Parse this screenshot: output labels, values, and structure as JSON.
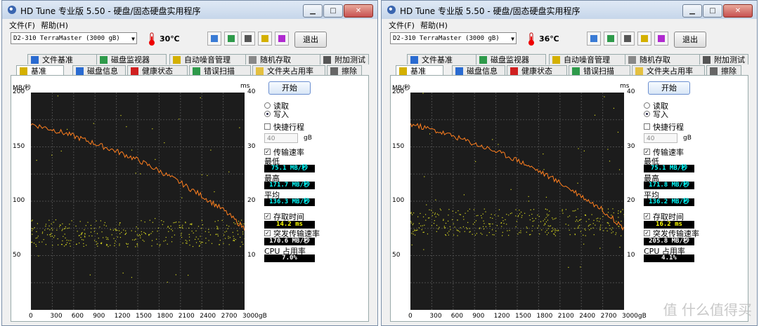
{
  "windows": [
    {
      "title": "HD Tune 专业版 5.50 - 硬盘/固态硬盘实用程序",
      "menu": [
        "文件(F)",
        "帮助(H)"
      ],
      "drive": "D2-310  TerraMaster (3000 gB)",
      "temperature": "30℃",
      "exit_label": "退出",
      "tabs_row1": [
        "文件基准",
        "磁盘监视器",
        "自动噪音管理",
        "随机存取",
        "附加测试"
      ],
      "tabs_row2": [
        "基准",
        "磁盘信息",
        "健康状态",
        "错误扫描",
        "文件夹占用率",
        "擦除"
      ],
      "start_label": "开始",
      "read_label": "读取",
      "write_label": "写入",
      "short_stroke_label": "快捷行程",
      "short_stroke_value": "40",
      "short_stroke_unit": "gB",
      "transfer_label": "传输速率",
      "min_label": "最低",
      "min_value": "75.1 MB/秒",
      "max_label": "最高",
      "max_value": "171.7 MB/秒",
      "avg_label": "平均",
      "avg_value": "136.3 MB/秒",
      "access_label": "存取时间",
      "access_value": "14.2 ms",
      "burst_label": "突发传输速率",
      "burst_value": "170.6 MB/秒",
      "cpu_label": "CPU 占用率",
      "cpu_value": "7.0%",
      "ylabel_left": "MB/秒",
      "ylabel_right": "ms",
      "y_left_ticks": [
        "200",
        "150",
        "100",
        "50"
      ],
      "y_right_ticks": [
        "40",
        "30",
        "20",
        "10"
      ],
      "x_ticks": [
        "0",
        "300",
        "600",
        "900",
        "1200",
        "1500",
        "1800",
        "2100",
        "2400",
        "2700",
        "3000gB"
      ],
      "chart_data": {
        "type": "line",
        "x": [
          0,
          300,
          600,
          900,
          1200,
          1500,
          1800,
          2100,
          2400,
          2700,
          3000
        ],
        "series": [
          {
            "values": [
              171,
              166,
              160,
              153,
              146,
              138,
              128,
              117,
              105,
              92,
              75
            ]
          }
        ],
        "ylim_left": [
          0,
          200
        ],
        "ylim_right": [
          0,
          40
        ],
        "access_band_ms": 14.2,
        "grid": true
      },
      "colors": {
        "line": "#ff7f1f",
        "dots": "#d8d820",
        "min": "#00ffff",
        "access": "#ffff00",
        "cpu": "#ffffff"
      }
    },
    {
      "title": "HD Tune 专业版 5.50 - 硬盘/固态硬盘实用程序",
      "menu": [
        "文件(F)",
        "帮助(H)"
      ],
      "drive": "D2-310  TerraMaster (3000 gB)",
      "temperature": "36℃",
      "exit_label": "退出",
      "tabs_row1": [
        "文件基准",
        "磁盘监视器",
        "自动噪音管理",
        "随机存取",
        "附加测试"
      ],
      "tabs_row2": [
        "基准",
        "磁盘信息",
        "健康状态",
        "错误扫描",
        "文件夹占用率",
        "擦除"
      ],
      "start_label": "开始",
      "read_label": "读取",
      "write_label": "写入",
      "short_stroke_label": "快捷行程",
      "short_stroke_value": "40",
      "short_stroke_unit": "gB",
      "transfer_label": "传输速率",
      "min_label": "最低",
      "min_value": "75.1 MB/秒",
      "max_label": "最高",
      "max_value": "171.8 MB/秒",
      "avg_label": "平均",
      "avg_value": "136.2 MB/秒",
      "access_label": "存取时间",
      "access_value": "16.2 ms",
      "burst_label": "突发传输速率",
      "burst_value": "205.8 MB/秒",
      "cpu_label": "CPU 占用率",
      "cpu_value": "4.1%",
      "ylabel_left": "MB/秒",
      "ylabel_right": "ms",
      "y_left_ticks": [
        "200",
        "150",
        "100",
        "50"
      ],
      "y_right_ticks": [
        "40",
        "30",
        "20",
        "10"
      ],
      "x_ticks": [
        "0",
        "300",
        "600",
        "900",
        "1200",
        "1500",
        "1800",
        "2100",
        "2400",
        "2700",
        "3000gB"
      ],
      "chart_data": {
        "type": "line",
        "x": [
          0,
          300,
          600,
          900,
          1200,
          1500,
          1800,
          2100,
          2400,
          2700,
          3000
        ],
        "series": [
          {
            "values": [
              171,
              166,
              160,
              153,
              146,
              138,
              128,
              117,
              105,
              92,
              75
            ]
          }
        ],
        "ylim_left": [
          0,
          200
        ],
        "ylim_right": [
          0,
          40
        ],
        "access_band_ms": 16.2,
        "grid": true
      },
      "colors": {
        "line": "#ff7f1f",
        "dots": "#d8d820",
        "min": "#00ffff",
        "access": "#ffff00",
        "cpu": "#ffffff"
      }
    }
  ],
  "watermark": "值 什么值得买"
}
